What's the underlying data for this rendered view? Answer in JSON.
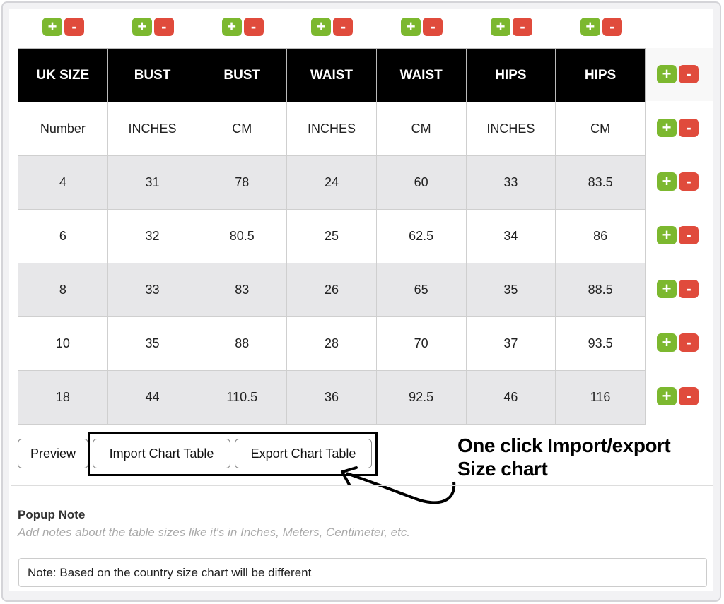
{
  "table": {
    "headers": [
      "UK SIZE",
      "BUST",
      "BUST",
      "WAIST",
      "WAIST",
      "HIPS",
      "HIPS"
    ],
    "rows": [
      [
        "Number",
        "INCHES",
        "CM",
        "INCHES",
        "CM",
        "INCHES",
        "CM"
      ],
      [
        "4",
        "31",
        "78",
        "24",
        "60",
        "33",
        "83.5"
      ],
      [
        "6",
        "32",
        "80.5",
        "25",
        "62.5",
        "34",
        "86"
      ],
      [
        "8",
        "33",
        "83",
        "26",
        "65",
        "35",
        "88.5"
      ],
      [
        "10",
        "35",
        "88",
        "28",
        "70",
        "37",
        "93.5"
      ],
      [
        "18",
        "44",
        "110.5",
        "36",
        "92.5",
        "46",
        "116"
      ]
    ],
    "add_symbol": "+",
    "remove_symbol": "-"
  },
  "colors": {
    "add": "#7cb82f",
    "remove": "#e04b3c",
    "header_bg": "#000000"
  },
  "buttons": {
    "preview": "Preview",
    "import": "Import Chart Table",
    "export": "Export Chart Table"
  },
  "annotation": {
    "line1": "One click Import/export",
    "line2": "Size chart"
  },
  "popup_note": {
    "label": "Popup Note",
    "hint": "Add notes about the table sizes like it's in Inches, Meters, Centimeter, etc.",
    "value": "Note: Based on the country size chart will be different"
  }
}
